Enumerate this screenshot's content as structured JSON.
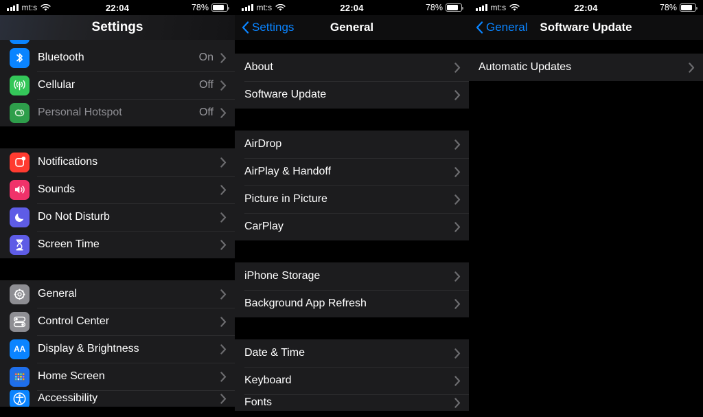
{
  "status_bar": {
    "carrier": "mt:s",
    "time": "22:04",
    "battery_percent": "78%",
    "signal_icon": "signal-bars-icon",
    "wifi_icon": "wifi-icon",
    "battery_icon": "battery-icon"
  },
  "colors": {
    "accent_blue": "#0a84ff",
    "row_bg": "#1c1c1e",
    "page_bg": "#000000",
    "separator": "#2d2d2f",
    "secondary_text": "#98989d"
  },
  "panels": {
    "settings": {
      "title": "Settings",
      "groups": [
        {
          "rows": [
            {
              "label": "Bluetooth",
              "value": "On",
              "icon": "bluetooth-icon",
              "icon_color": "#0a84ff",
              "dim": false
            },
            {
              "label": "Cellular",
              "value": "Off",
              "icon": "cellular-icon",
              "icon_color": "#34c759",
              "dim": false
            },
            {
              "label": "Personal Hotspot",
              "value": "Off",
              "icon": "personal-hotspot-icon",
              "icon_color": "#30a14e",
              "dim": true
            }
          ]
        },
        {
          "rows": [
            {
              "label": "Notifications",
              "value": "",
              "icon": "notifications-icon",
              "icon_color": "#ff3b30",
              "dim": false
            },
            {
              "label": "Sounds",
              "value": "",
              "icon": "sounds-icon",
              "icon_color": "#f0326a",
              "dim": false
            },
            {
              "label": "Do Not Disturb",
              "value": "",
              "icon": "do-not-disturb-icon",
              "icon_color": "#5e5ce6",
              "dim": false
            },
            {
              "label": "Screen Time",
              "value": "",
              "icon": "screen-time-icon",
              "icon_color": "#5e5ce6",
              "dim": false
            }
          ]
        },
        {
          "rows": [
            {
              "label": "General",
              "value": "",
              "icon": "gear-icon",
              "icon_color": "#8e8e93",
              "dim": false
            },
            {
              "label": "Control Center",
              "value": "",
              "icon": "control-center-icon",
              "icon_color": "#8e8e93",
              "dim": false
            },
            {
              "label": "Display & Brightness",
              "value": "",
              "icon": "display-brightness-icon",
              "icon_color": "#0a84ff",
              "dim": false
            },
            {
              "label": "Home Screen",
              "value": "",
              "icon": "home-screen-icon",
              "icon_color": "#1f6feb",
              "dim": false
            },
            {
              "label": "Accessibility",
              "value": "",
              "icon": "accessibility-icon",
              "icon_color": "#0a84ff",
              "dim": false
            }
          ]
        }
      ]
    },
    "general": {
      "title": "General",
      "back_label": "Settings",
      "back_icon": "chevron-left-icon",
      "groups": [
        {
          "rows": [
            {
              "label": "About"
            },
            {
              "label": "Software Update"
            }
          ]
        },
        {
          "rows": [
            {
              "label": "AirDrop"
            },
            {
              "label": "AirPlay & Handoff"
            },
            {
              "label": "Picture in Picture"
            },
            {
              "label": "CarPlay"
            }
          ]
        },
        {
          "rows": [
            {
              "label": "iPhone Storage"
            },
            {
              "label": "Background App Refresh"
            }
          ]
        },
        {
          "rows": [
            {
              "label": "Date & Time"
            },
            {
              "label": "Keyboard"
            },
            {
              "label": "Fonts"
            }
          ]
        }
      ]
    },
    "software_update": {
      "title": "Software Update",
      "back_label": "General",
      "back_icon": "chevron-left-icon",
      "groups": [
        {
          "rows": [
            {
              "label": "Automatic Updates"
            }
          ]
        }
      ]
    }
  }
}
